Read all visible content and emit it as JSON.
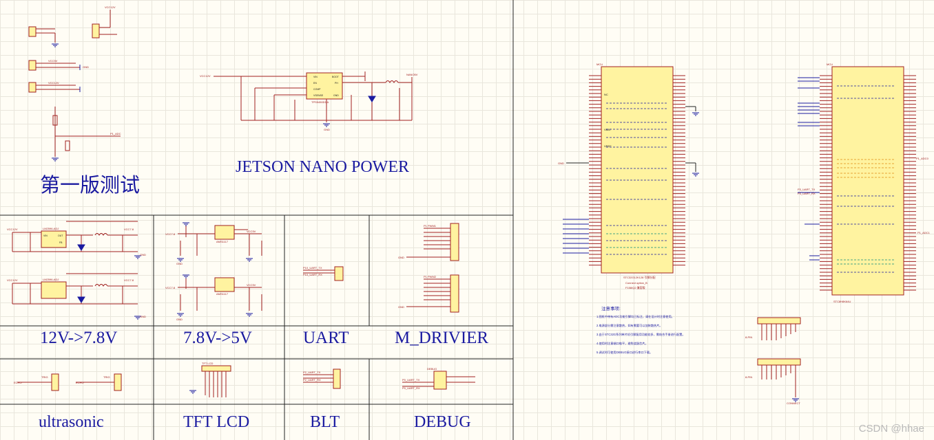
{
  "block_titles": {
    "first_test": "第一版测试",
    "jetson_power": "JETSON NANO POWER",
    "reg_12_78": "12V->7.8V",
    "reg_78_5": "7.8V->5V",
    "uart": "UART",
    "m_driver": "M_DRIVIER",
    "ultrasonic": "ultrasonic",
    "tft_lcd": "TFT LCD",
    "blt": "BLT",
    "debug": "DEBUG"
  },
  "net_labels": {
    "vcc12v": "VCC12V",
    "vcc5v": "VCC5V",
    "vcc_7v8": "VCC7.8",
    "gnd": "GND",
    "gnd_small": "GND",
    "sw_vcc": "SW_VCC",
    "bat_adc": "P1_ADC",
    "nano5v": "NANO5V",
    "jetson_ic": "TPS5450DDA",
    "ic_vin": "VIN",
    "ic_boot": "BOOT",
    "ic_ph": "PH",
    "ic_en": "EN",
    "ic_comp": "COMP",
    "ic_vsense": "VSENSE",
    "ic_gnd": "GND",
    "lm_ic": "LM2596-ADJ",
    "lm_ic2": "LM2596-ADJ",
    "vin": "VIN",
    "out": "OUT",
    "fb": "FB",
    "ams": "AMS1117",
    "ams2": "AMS1117",
    "uart_tx": "P10_UART_TX",
    "uart_rx": "P10_UART_RX",
    "m_pwm1": "P1 PWM1",
    "m_pwm2": "P1 PWM2",
    "hc_trig": "TRIG",
    "hc_echo": "ECHO",
    "tft_lcd": "TFT LCD",
    "blt_tx": "P2_UART_TX",
    "blt_rx": "P2_UART_RX",
    "debug_tx": "P0_UART_TX",
    "debug_rx": "P0_UART_RX",
    "debug_ref": "DEBUG",
    "mcu_top": "MCU",
    "mcu_title": "STC32G12K128 引脚分配",
    "mcu_sub": "Connect option_B",
    "mcu_sub2": "F158/Q2 兼容版",
    "mcu2_top": "MCU",
    "mcu2_name": "STC8H8K64U",
    "nc": "NC",
    "vbat": "VBAT",
    "vref": "VREF",
    "p1_adc0": "P1_ADC0",
    "p1_adc1": "P1_ADC1",
    "p3_uart_tx": "P3_UART_TX",
    "p3_uart_rx": "P3_UART_RX",
    "hdr1": "8-PIN",
    "hdr2": "8-PIN",
    "hdr_conn": "CONNECT"
  },
  "notes_title": "注意事项:",
  "notes": [
    "1.图纸中带有ADC功能引脚均已标注，请在设计时注意使用。",
    "2.电源部分需注意散热，如有需要可以加装散热片。",
    "3.由于STC32G系列单片机引脚复用功能较多，需结合手册进行配置。",
    "4.使用时注意端口电平，避免烧毁芯片。",
    "5.调试时可使用DEBUG接口进行串口下载。"
  ],
  "watermark": "CSDN @hhae"
}
